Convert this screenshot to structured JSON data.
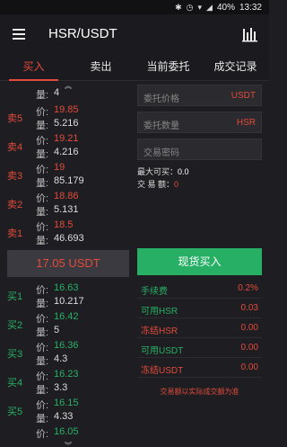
{
  "statusbar": {
    "battery": "40%",
    "time": "13:32"
  },
  "header": {
    "title": "HSR/USDT",
    "menu_icon": "menu-icon",
    "chart_icon": "chart-icon"
  },
  "tabs": [
    "买入",
    "卖出",
    "当前委托",
    "成交记录"
  ],
  "book": {
    "price_label": "价:",
    "qty_label": "量:",
    "top_partial_qty": "4",
    "sells": [
      {
        "label": "卖5",
        "price": "19.85",
        "qty": "5.216"
      },
      {
        "label": "卖4",
        "price": "19.21",
        "qty": "4.216"
      },
      {
        "label": "卖3",
        "price": "19",
        "qty": "85.179"
      },
      {
        "label": "卖2",
        "price": "18.86",
        "qty": "5.131"
      },
      {
        "label": "卖1",
        "price": "18.5",
        "qty": "46.693"
      }
    ],
    "last_price": "17.05 USDT",
    "buys": [
      {
        "label": "买1",
        "price": "16.63",
        "qty": "10.217"
      },
      {
        "label": "买2",
        "price": "16.42",
        "qty": "5"
      },
      {
        "label": "买3",
        "price": "16.36",
        "qty": "4.3"
      },
      {
        "label": "买4",
        "price": "16.23",
        "qty": "3.3"
      },
      {
        "label": "买5",
        "price": "16.15",
        "qty": "4.33"
      }
    ],
    "bottom_partial_price": "16.05"
  },
  "form": {
    "price_placeholder": "委托价格",
    "price_unit": "USDT",
    "qty_placeholder": "委托数量",
    "qty_unit": "HSR",
    "password_placeholder": "交易密码",
    "max_buy_label": "最大可买：",
    "max_buy_value": "0.0",
    "trade_amount_label": "交 易 额：",
    "trade_amount_value": "0",
    "buy_button": "现货买入",
    "fee_label": "手续费",
    "fee_value": "0.2%",
    "avail_hsr_label": "可用HSR",
    "avail_hsr_value": "0.03",
    "frozen_hsr_label": "冻结HSR",
    "frozen_hsr_value": "0.00",
    "avail_usdt_label": "可用USDT",
    "avail_usdt_value": "0.00",
    "frozen_usdt_label": "冻结USDT",
    "frozen_usdt_value": "0.00",
    "note": "交易额以实际成交额为准"
  }
}
